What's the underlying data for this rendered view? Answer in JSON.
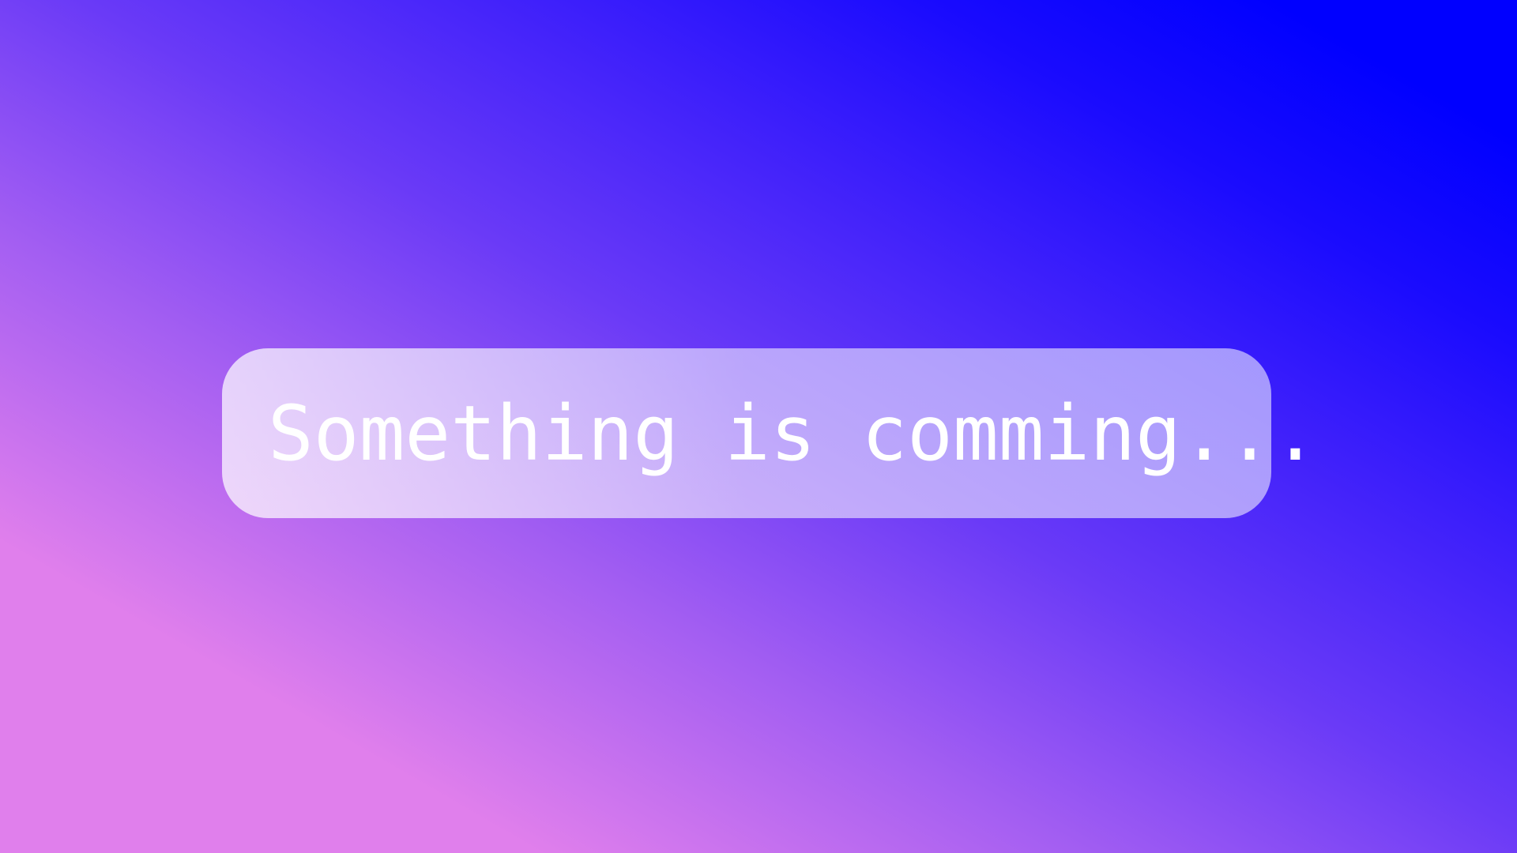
{
  "banner": {
    "message": "Something is comming..."
  },
  "colors": {
    "gradient_pink": "#e07fec",
    "gradient_purple": "#6a3af7",
    "gradient_blue": "#0000ff",
    "text": "#ffffff"
  }
}
